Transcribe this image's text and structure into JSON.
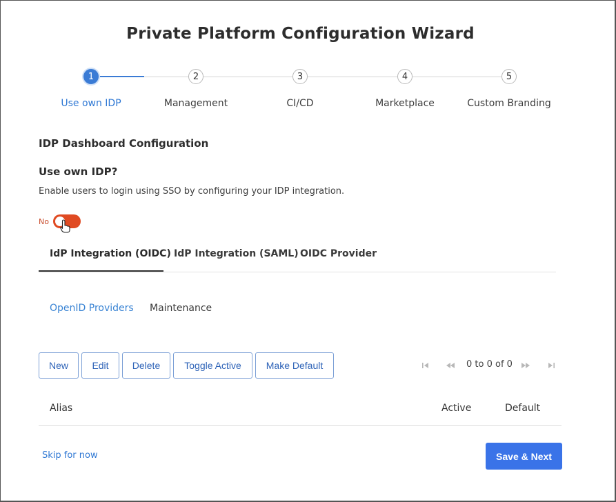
{
  "title": "Private Platform Configuration Wizard",
  "steps": [
    {
      "number": "1",
      "label": "Use own IDP",
      "active": true
    },
    {
      "number": "2",
      "label": "Management",
      "active": false
    },
    {
      "number": "3",
      "label": "CI/CD",
      "active": false
    },
    {
      "number": "4",
      "label": "Marketplace",
      "active": false
    },
    {
      "number": "5",
      "label": "Custom Branding",
      "active": false
    }
  ],
  "section_heading": "IDP Dashboard Configuration",
  "question": "Use own IDP?",
  "description": "Enable users to login using SSO by configuring your IDP integration.",
  "toggle": {
    "label": "No",
    "on": false
  },
  "tabs": [
    {
      "label": "IdP Integration (OIDC)",
      "active": true
    },
    {
      "label": "IdP Integration (SAML)",
      "active": false
    },
    {
      "label": "OIDC Provider",
      "active": false
    }
  ],
  "subtabs": [
    {
      "label": "OpenID Providers",
      "active": true
    },
    {
      "label": "Maintenance",
      "active": false
    }
  ],
  "toolbar": {
    "new": "New",
    "edit": "Edit",
    "delete": "Delete",
    "toggle_active": "Toggle Active",
    "make_default": "Make Default"
  },
  "pager": {
    "text": "0 to 0 of 0"
  },
  "table": {
    "columns": [
      "Alias",
      "Active",
      "Default"
    ]
  },
  "footer": {
    "skip": "Skip for now",
    "save_next": "Save & Next"
  },
  "colors": {
    "accent": "#3a73e8",
    "toggle_off": "#e04a22"
  },
  "icons": [
    "first-page-icon",
    "previous-page-icon",
    "next-page-icon",
    "last-page-icon",
    "pointer-cursor-icon"
  ]
}
